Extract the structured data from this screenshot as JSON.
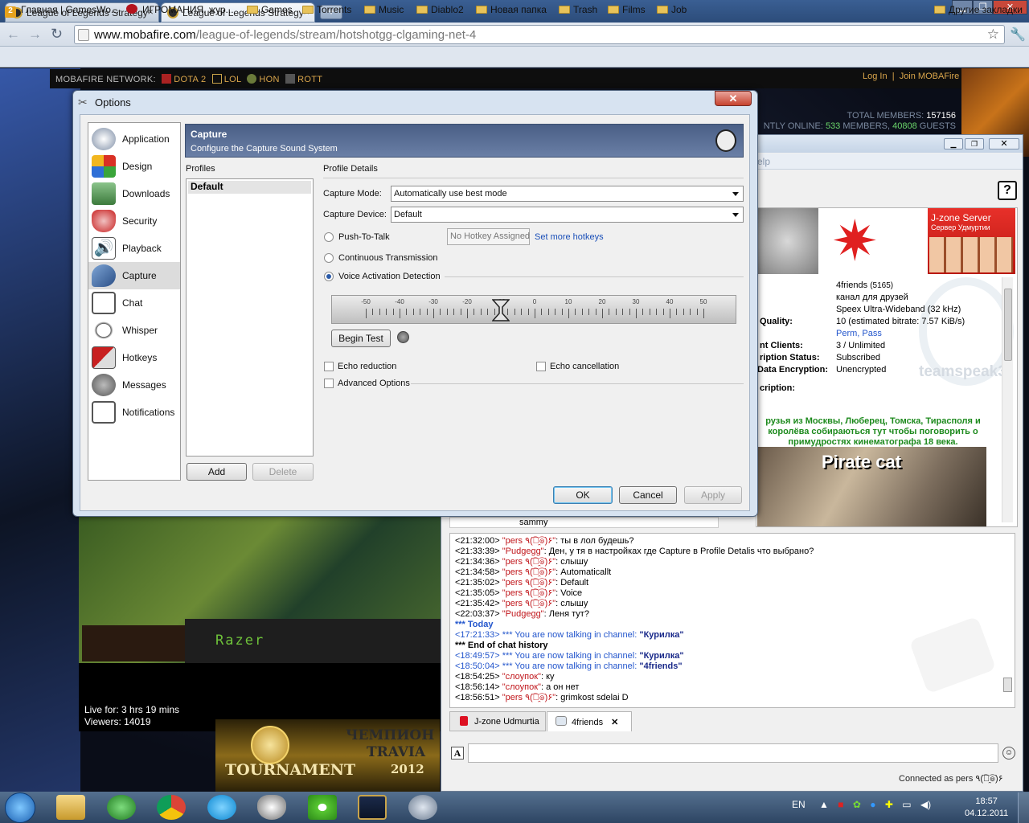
{
  "browser": {
    "tabs": [
      {
        "title": "League of Legends Strategy"
      },
      {
        "title": "League of Legends Strategy"
      }
    ],
    "url_host": "www.mobafire.com",
    "url_path": "/league-of-legends/stream/hotshotgg-clgaming-net-4",
    "bookmarks": [
      {
        "label": "Главная | GamesWo..."
      },
      {
        "label": "ИГРОМАНИЯ, жур..."
      },
      {
        "label": "Games"
      },
      {
        "label": "Torrents"
      },
      {
        "label": "Music"
      },
      {
        "label": "Diablo2"
      },
      {
        "label": "Новая папка"
      },
      {
        "label": "Trash"
      },
      {
        "label": "Films"
      },
      {
        "label": "Job"
      }
    ],
    "other_bookmarks": "Другие закладки"
  },
  "site": {
    "network_label": "MOBAFIRE NETWORK:",
    "network_links": [
      "DOTA 2",
      "LOL",
      "HON",
      "ROTT"
    ],
    "login": "Log In",
    "join": "Join MOBAFire",
    "total_members_label": "TOTAL MEMBERS:",
    "total_members": "157156",
    "online_prefix": "NTLY ONLINE:",
    "online_members": "533",
    "members_word": "MEMBERS,",
    "guests": "40808",
    "guests_word": "GUESTS",
    "live_for": "Live for: 3 hrs 19 mins",
    "viewers": "Viewers: 14019",
    "banner_left": "TOURNAMENT",
    "banner_right_1": "ЧЕМПИОН",
    "banner_right_2": "TRAVIA",
    "banner_year": "2012",
    "razer": "Razer"
  },
  "teamspeak": {
    "help_fragment": "elp",
    "banner_title": "J-zone Server",
    "banner_sub": "Сервер Удмуртии",
    "info_labels": [
      "Quality:",
      "nt Clients:",
      "ription Status:",
      "Data Encryption:",
      "cription:"
    ],
    "channel_name": "4friends",
    "channel_count": "(5165)",
    "channel_topic": "канал для друзей",
    "codec": "Speex Ultra-Wideband (32 kHz)",
    "quality": "10 (estimated bitrate: 7.57 KiB/s)",
    "perm": "Perm",
    "pass": "Pass",
    "clients": "3 / Unlimited",
    "subscription": "Subscribed",
    "encryption": "Unencrypted",
    "description": "рузья из Москвы, Люберец, Томска, Тирасполя и королёва собираються тут чтобы поговорить о примудростях кинематографа 18 века.",
    "pirate_cat": "Pirate cat",
    "ts3_watermark": "teamspeak3",
    "client_sammy": "sammy",
    "chat": [
      {
        "time": "<21:32:00>",
        "name": "\"pers ٩(͡๏̯͡๏)۶\"",
        "msg": ": ты в лол будешь?",
        "type": "user"
      },
      {
        "time": "<21:33:39>",
        "name": "\"Pudgegg\"",
        "msg": ": Ден, у тя в настройках где Capture в Profile Detalis что выбрано?",
        "type": "user"
      },
      {
        "time": "<21:34:36>",
        "name": "\"pers ٩(͡๏̯͡๏)۶\"",
        "msg": ": слышу",
        "type": "user"
      },
      {
        "time": "<21:34:58>",
        "name": "\"pers ٩(͡๏̯͡๏)۶\"",
        "msg": ": Automaticallt",
        "type": "user"
      },
      {
        "time": "<21:35:02>",
        "name": "\"pers ٩(͡๏̯͡๏)۶\"",
        "msg": ": Default",
        "type": "user"
      },
      {
        "time": "<21:35:05>",
        "name": "\"pers ٩(͡๏̯͡๏)۶\"",
        "msg": ": Voice",
        "type": "user"
      },
      {
        "time": "<21:35:42>",
        "name": "\"pers ٩(͡๏̯͡๏)۶\"",
        "msg": ": слышу",
        "type": "user"
      },
      {
        "time": "<22:03:37>",
        "name": "\"Pudgegg\"",
        "msg": ": Леня тут?",
        "type": "user"
      },
      {
        "time": "",
        "name": "",
        "msg": "*** Today",
        "type": "today"
      },
      {
        "time": "<17:21:33>",
        "name": "*** You are now talking in channel: ",
        "msg": "\"Курилка\"",
        "type": "sys"
      },
      {
        "time": "",
        "name": "",
        "msg": "*** End of chat history",
        "type": "end"
      },
      {
        "time": "<18:49:57>",
        "name": "*** You are now talking in channel: ",
        "msg": "\"Курилка\"",
        "type": "sys"
      },
      {
        "time": "<18:50:04>",
        "name": "*** You are now talking in channel: ",
        "msg": "\"4friends\"",
        "type": "sys"
      },
      {
        "time": "<18:54:25>",
        "name": "\"слоупок\"",
        "msg": ": ку",
        "type": "user"
      },
      {
        "time": "<18:56:14>",
        "name": "\"слоупок\"",
        "msg": ": а он нет",
        "type": "user"
      },
      {
        "time": "<18:56:51>",
        "name": "\"pers ٩(͡๏̯͡๏)۶\"",
        "msg": ": grimkost sdelai D",
        "type": "user"
      }
    ],
    "chat_tabs": [
      "J-zone Udmurtia",
      "4friends"
    ],
    "connected_as": "Connected as pers ٩(͡๏̯͡๏)۶"
  },
  "options": {
    "title": "Options",
    "categories": [
      "Application",
      "Design",
      "Downloads",
      "Security",
      "Playback",
      "Capture",
      "Chat",
      "Whisper",
      "Hotkeys",
      "Messages",
      "Notifications"
    ],
    "selected_category": "Capture",
    "header_title": "Capture",
    "header_subtitle": "Configure the Capture Sound System",
    "profiles_label": "Profiles",
    "profiles": [
      "Default"
    ],
    "profile_details_label": "Profile Details",
    "capture_mode_label": "Capture Mode:",
    "capture_mode_value": "Automatically use best mode",
    "capture_device_label": "Capture Device:",
    "capture_device_value": "Default",
    "ptt_label": "Push-To-Talk",
    "hotkey_value": "No Hotkey Assigned",
    "set_more_hotkeys": "Set more hotkeys",
    "continuous_label": "Continuous Transmission",
    "vad_label": "Voice Activation Detection",
    "vad_selected": true,
    "slider_ticks": [
      "-50",
      "-40",
      "-30",
      "-20",
      "-10",
      "0",
      "10",
      "20",
      "30",
      "40",
      "50"
    ],
    "slider_value": -10,
    "begin_test": "Begin Test",
    "echo_reduction": "Echo reduction",
    "echo_cancellation": "Echo cancellation",
    "advanced_options": "Advanced Options",
    "add": "Add",
    "delete": "Delete",
    "ok": "OK",
    "cancel": "Cancel",
    "apply": "Apply"
  },
  "taskbar": {
    "lang": "EN",
    "time": "18:57",
    "date": "04.12.2011"
  }
}
